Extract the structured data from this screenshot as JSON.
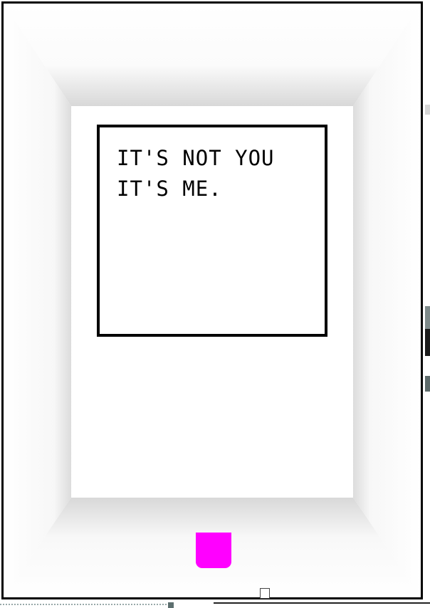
{
  "screen": {
    "lines": [
      "IT'S NOT YOU",
      "IT'S ME."
    ]
  },
  "colors": {
    "player": "#ff00ff",
    "frame": "#000000",
    "wall": "#ffffff"
  },
  "icons": {
    "player": "magenta-block",
    "cursor": "small-square"
  }
}
